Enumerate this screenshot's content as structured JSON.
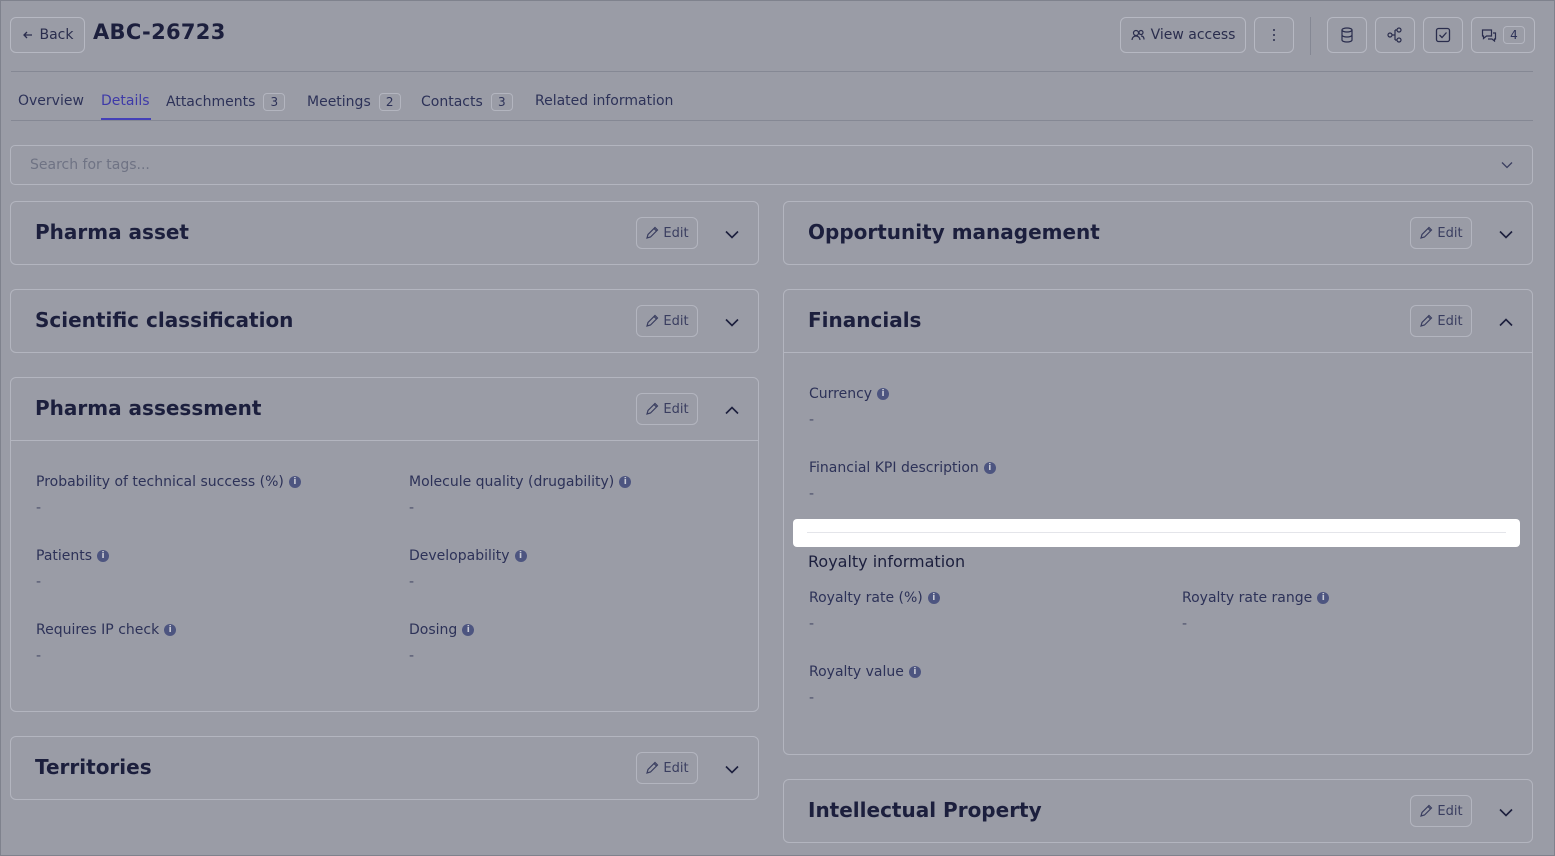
{
  "header": {
    "back_label": "Back",
    "title": "ABC-26723",
    "view_access_label": "View access",
    "comments_count": "4"
  },
  "tabs": [
    {
      "label": "Overview",
      "count": ""
    },
    {
      "label": "Details",
      "count": ""
    },
    {
      "label": "Attachments",
      "count": "3"
    },
    {
      "label": "Meetings",
      "count": "2"
    },
    {
      "label": "Contacts",
      "count": "3"
    },
    {
      "label": "Related information",
      "count": ""
    }
  ],
  "search": {
    "placeholder": "Search for tags..."
  },
  "edit_label": "Edit",
  "cards": {
    "pharma_asset": {
      "title": "Pharma asset"
    },
    "scientific_classification": {
      "title": "Scientific classification"
    },
    "pharma_assessment": {
      "title": "Pharma assessment",
      "fields": [
        {
          "label": "Probability of technical success (%)",
          "value": "-"
        },
        {
          "label": "Molecule quality (drugability)",
          "value": "-"
        },
        {
          "label": "Patients",
          "value": "-"
        },
        {
          "label": "Developability",
          "value": "-"
        },
        {
          "label": "Requires IP check",
          "value": "-"
        },
        {
          "label": "Dosing",
          "value": "-"
        }
      ]
    },
    "territories": {
      "title": "Territories"
    },
    "opportunity_management": {
      "title": "Opportunity management"
    },
    "financials": {
      "title": "Financials",
      "fields": [
        {
          "label": "Currency",
          "value": "-"
        },
        {
          "label": "Financial KPI description",
          "value": "-"
        }
      ],
      "royalty_section_title": "Royalty information",
      "royalty_fields": [
        {
          "label": "Royalty rate (%)",
          "value": "-"
        },
        {
          "label": "Royalty rate range",
          "value": "-"
        },
        {
          "label": "Royalty value",
          "value": "-"
        }
      ]
    },
    "intellectual_property": {
      "title": "Intellectual Property"
    }
  },
  "colors": {
    "overlay_background": "#9a9ca6",
    "accent": "#4440b8",
    "text": "#1c1f3d"
  }
}
